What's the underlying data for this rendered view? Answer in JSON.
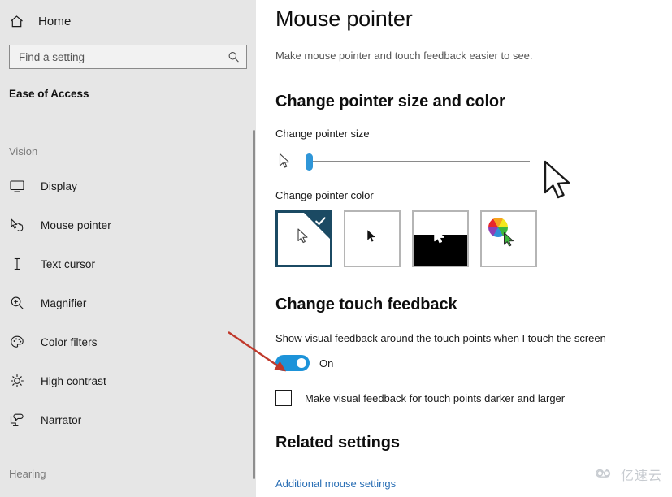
{
  "sidebar": {
    "home_label": "Home",
    "home_icon": "home-icon",
    "search": {
      "placeholder": "Find a setting",
      "value": "",
      "icon": "search-icon"
    },
    "category_title": "Ease of Access",
    "groups": [
      {
        "label": "Vision"
      },
      {
        "label": "Hearing"
      }
    ],
    "items": [
      {
        "label": "Display",
        "icon": "monitor-icon"
      },
      {
        "label": "Mouse pointer",
        "icon": "hand-pointer-icon"
      },
      {
        "label": "Text cursor",
        "icon": "text-cursor-icon"
      },
      {
        "label": "Magnifier",
        "icon": "magnifier-icon"
      },
      {
        "label": "Color filters",
        "icon": "palette-icon"
      },
      {
        "label": "High contrast",
        "icon": "brightness-icon"
      },
      {
        "label": "Narrator",
        "icon": "narrator-icon"
      }
    ]
  },
  "main": {
    "title": "Mouse pointer",
    "subtitle": "Make mouse pointer and touch feedback easier to see.",
    "section_pointer": {
      "heading": "Change pointer size and color",
      "size_label": "Change pointer size",
      "slider_value": 1,
      "slider_min": 1,
      "slider_max": 15,
      "color_label": "Change pointer color",
      "tiles": [
        {
          "name": "white-pointer",
          "selected": true
        },
        {
          "name": "black-pointer",
          "selected": false
        },
        {
          "name": "inverted-pointer",
          "selected": false
        },
        {
          "name": "custom-color-pointer",
          "selected": false
        }
      ]
    },
    "section_touch": {
      "heading": "Change touch feedback",
      "toggle_desc": "Show visual feedback around the touch points when I touch the screen",
      "toggle_state": "On",
      "checkbox_label": "Make visual feedback for touch points darker and larger",
      "checkbox_checked": false
    },
    "section_related": {
      "heading": "Related settings",
      "link_label": "Additional mouse settings"
    }
  },
  "annotation": {
    "arrow_color": "#c0392b",
    "target": "touch-feedback-toggle"
  },
  "watermark": {
    "text": "亿速云",
    "icon": "cloud-icon"
  },
  "colors": {
    "accent_blue": "#1d93d9",
    "slider_blue": "#2f96d8",
    "selected_tile": "#1b4a63",
    "sidebar_bg": "#e6e6e6",
    "link": "#2a6fb5"
  }
}
